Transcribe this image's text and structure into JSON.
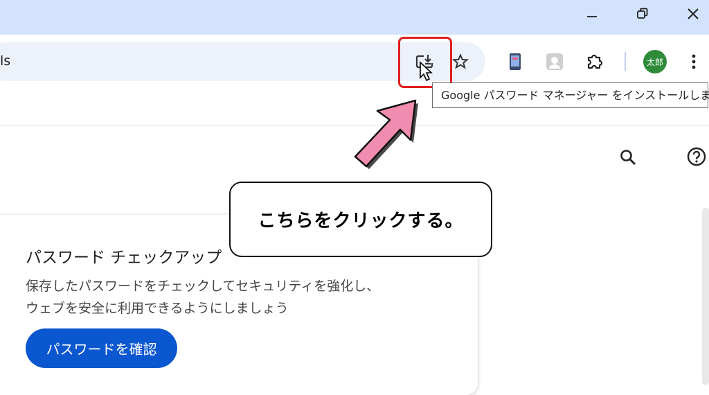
{
  "omnibox": {
    "url_fragment": "ls"
  },
  "toolbar": {
    "install_icon": "install-app-icon",
    "bookmark_icon": "star-icon",
    "extension_icon": "puzzle-icon",
    "profile_label": "太郎",
    "menu_icon": "more-vert-icon"
  },
  "tooltip": {
    "text": "Google パスワード マネージャー をインストールします"
  },
  "callout": {
    "text": "こちらをクリックする。"
  },
  "card": {
    "title": "パスワード チェックアップ",
    "description_line1": "保存したパスワードをチェックしてセキュリティを強化し、",
    "description_line2": "ウェブを安全に利用できるようにしましょう",
    "button_label": "パスワードを確認"
  },
  "colors": {
    "titlebar": "#d3e3fd",
    "omnibox": "#edf2fa",
    "primary": "#0b57d0",
    "highlight": "#e02020",
    "arrow": "#f08cb0",
    "avatar": "#2e8b3a"
  }
}
